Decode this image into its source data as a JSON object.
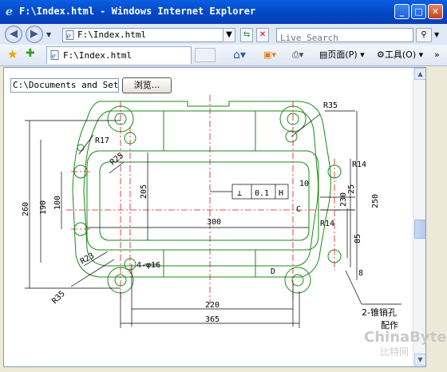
{
  "window": {
    "title": "F:\\Index.html - Windows Internet Explorer",
    "minimize_glyph": "_",
    "maximize_glyph": "□",
    "close_glyph": "✕"
  },
  "address": {
    "url": "F:\\Index.html",
    "search_placeholder": "Live Search"
  },
  "tab": {
    "label": "F:\\Index.html"
  },
  "toolbar": {
    "page_label": "页面(P)",
    "tools_label": "工具(O)"
  },
  "form": {
    "file_value": "C:\\Documents and Settings",
    "browse_label": "浏览..."
  },
  "drawing": {
    "labels": {
      "r35_top": "R35",
      "r17": "R17",
      "r25": "R25",
      "r14_right": "R14",
      "r14_mid": "R14",
      "r23": "R23",
      "r35_bottom": "R35",
      "d205": "205",
      "d190": "190",
      "d100": "100",
      "d260": "260",
      "d300": "300",
      "d10": "10",
      "d25": "25",
      "d230": "230",
      "d250": "250",
      "d85": "85",
      "d8": "8",
      "holes": "4-φ16",
      "d220": "220",
      "d365": "365",
      "tol_sym": "⊥",
      "tol_val": "0.1",
      "tol_ref": "H",
      "c_mark": "C",
      "d_mark": "D",
      "pin_note": "2-锥销孔",
      "pin_note2": "配作"
    }
  },
  "watermark": {
    "line1": "ChinaByte",
    "line2": "比特网"
  }
}
